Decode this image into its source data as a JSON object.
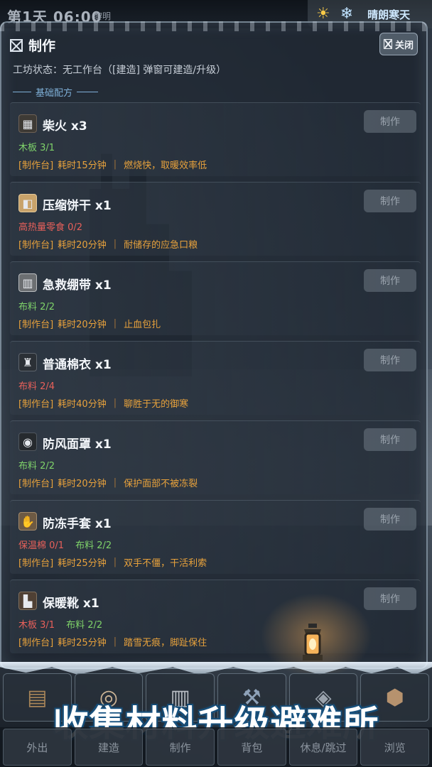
{
  "topbar": {
    "day_time": "第1天 06:00",
    "phase": "黎明",
    "weather_icons": [
      "sun-icon",
      "snowflake-icon"
    ],
    "weather_text": "晴朗寒天"
  },
  "modal": {
    "title": "制作",
    "close_label": "关闭",
    "workshop_status": "工坊状态：无工作台（[建造] 弹窗可建造/升级）",
    "section_title": "基础配方",
    "craft_label": "制作",
    "recipes": [
      {
        "name": "柴火 x3",
        "icon": "firewood-icon",
        "materials": [
          {
            "text": "木板 3/1",
            "ok": true
          }
        ],
        "station": "[制作台]",
        "time": "耗时15分钟",
        "desc": "燃烧快，取暖效率低"
      },
      {
        "name": "压缩饼干 x1",
        "icon": "biscuit-icon",
        "materials": [
          {
            "text": "高热量零食 0/2",
            "ok": false
          }
        ],
        "station": "[制作台]",
        "time": "耗时20分钟",
        "desc": "耐储存的应急口粮"
      },
      {
        "name": "急救绷带 x1",
        "icon": "bandage-icon",
        "materials": [
          {
            "text": "布料 2/2",
            "ok": true
          }
        ],
        "station": "[制作台]",
        "time": "耗时20分钟",
        "desc": "止血包扎"
      },
      {
        "name": "普通棉衣 x1",
        "icon": "coat-icon",
        "materials": [
          {
            "text": "布料 2/4",
            "ok": false
          }
        ],
        "station": "[制作台]",
        "time": "耗时40分钟",
        "desc": "聊胜于无的御寒"
      },
      {
        "name": "防风面罩 x1",
        "icon": "mask-icon",
        "materials": [
          {
            "text": "布料 2/2",
            "ok": true
          }
        ],
        "station": "[制作台]",
        "time": "耗时20分钟",
        "desc": "保护面部不被冻裂"
      },
      {
        "name": "防冻手套 x1",
        "icon": "gloves-icon",
        "materials": [
          {
            "text": "保温棉 0/1",
            "ok": false
          },
          {
            "text": "布料 2/2",
            "ok": true
          }
        ],
        "station": "[制作台]",
        "time": "耗时25分钟",
        "desc": "双手不僵，干活利索"
      },
      {
        "name": "保暖靴 x1",
        "icon": "boots-icon",
        "materials": [
          {
            "text": "木板 3/1",
            "ok": false
          },
          {
            "text": "布料 2/2",
            "ok": true
          }
        ],
        "station": "[制作台]",
        "time": "耗时25分钟",
        "desc": "踏雪无痕，脚趾保住"
      }
    ]
  },
  "inventory": {
    "slots": [
      "wood-planks-icon",
      "cloth-roll-icon",
      "bandage-roll-icon",
      "tool-icon",
      "fur-icon",
      "ore-icon"
    ]
  },
  "promo_text": "收集材料升级避难所",
  "nav": {
    "items": [
      "外出",
      "建造",
      "制作",
      "背包",
      "休息/跳过",
      "浏览"
    ]
  }
}
